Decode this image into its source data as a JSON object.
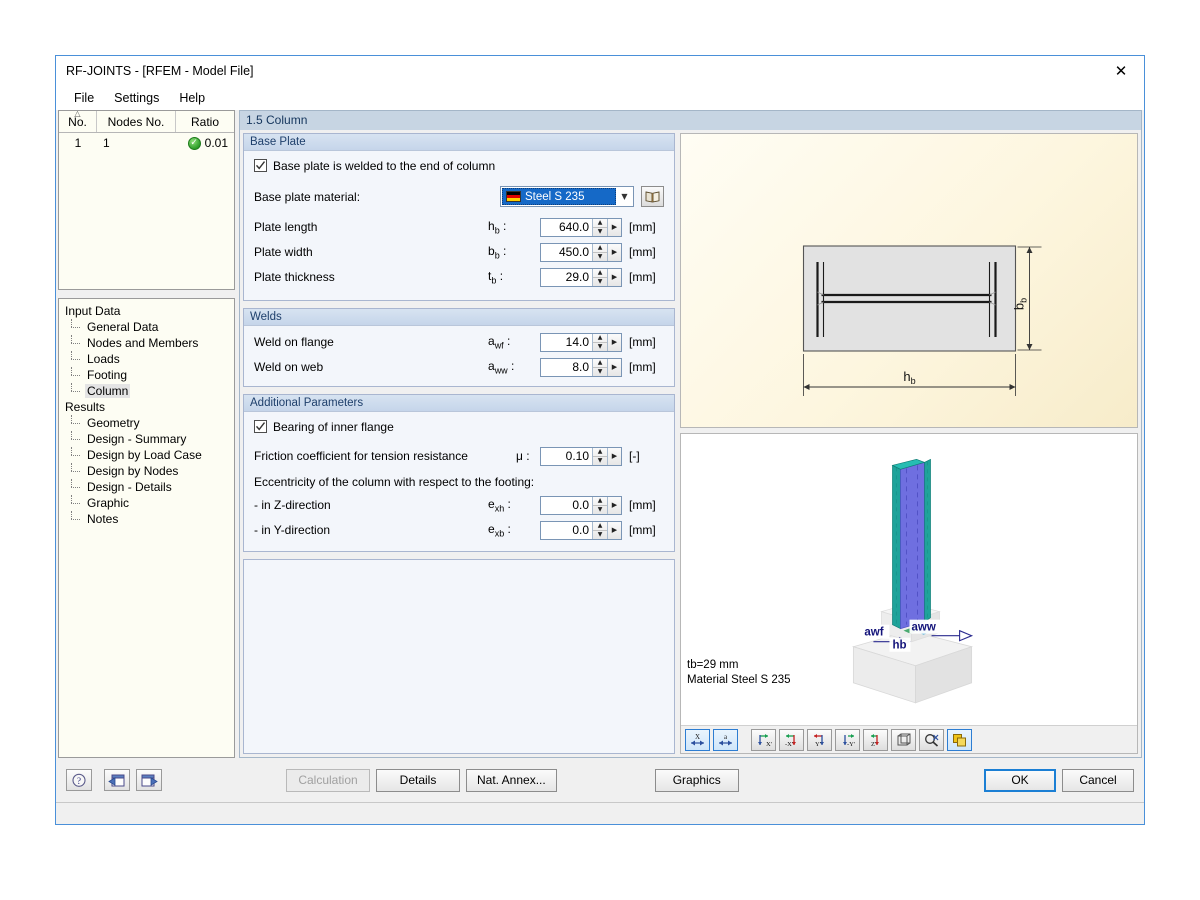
{
  "window": {
    "title": "RF-JOINTS - [RFEM - Model File]",
    "close_label": "✕"
  },
  "menu": {
    "items": [
      "File",
      "Settings",
      "Help"
    ]
  },
  "nodes_table": {
    "columns": [
      "No.",
      "Nodes No.",
      "Ratio"
    ],
    "rows": [
      {
        "no": "1",
        "nodes_no": "1",
        "ratio": "0.01",
        "status": "ok"
      }
    ]
  },
  "tree": {
    "groups": [
      {
        "label": "Input Data",
        "items": [
          "General Data",
          "Nodes and Members",
          "Loads",
          "Footing",
          "Column"
        ],
        "selected": "Column"
      },
      {
        "label": "Results",
        "items": [
          "Geometry",
          "Design - Summary",
          "Design by Load Case",
          "Design by Nodes",
          "Design - Details",
          "Graphic",
          "Notes"
        ],
        "selected": ""
      }
    ]
  },
  "tab": {
    "title": "1.5 Column"
  },
  "base_plate": {
    "title": "Base Plate",
    "welded_checkbox": {
      "label": "Base plate is welded to the end of column",
      "checked": true
    },
    "material_label": "Base plate material:",
    "material_value": "Steel S 235",
    "material_flag": "german-flag",
    "library_icon": "book-icon",
    "fields": [
      {
        "label": "Plate length",
        "symbol": "h",
        "sub": "b",
        "value": "640.0",
        "unit": "[mm]"
      },
      {
        "label": "Plate width",
        "symbol": "b",
        "sub": "b",
        "value": "450.0",
        "unit": "[mm]"
      },
      {
        "label": "Plate thickness",
        "symbol": "t",
        "sub": "b",
        "value": "29.0",
        "unit": "[mm]"
      }
    ]
  },
  "welds": {
    "title": "Welds",
    "fields": [
      {
        "label": "Weld on flange",
        "symbol": "a",
        "sub": "wf",
        "value": "14.0",
        "unit": "[mm]"
      },
      {
        "label": "Weld on web",
        "symbol": "a",
        "sub": "ww",
        "value": "8.0",
        "unit": "[mm]"
      }
    ]
  },
  "additional": {
    "title": "Additional Parameters",
    "bearing_checkbox": {
      "label": "Bearing of inner flange",
      "checked": true
    },
    "friction": {
      "label": "Friction coefficient for tension resistance",
      "symbol": "μ",
      "sub": "",
      "value": "0.10",
      "unit": "[-]"
    },
    "eccentricity_note": "Eccentricity of the column with respect to the footing:",
    "fields": [
      {
        "label": "- in Z-direction",
        "symbol": "e",
        "sub": "xh",
        "value": "0.0",
        "unit": "[mm]"
      },
      {
        "label": "- in Y-direction",
        "symbol": "e",
        "sub": "xb",
        "value": "0.0",
        "unit": "[mm]"
      }
    ]
  },
  "graphic_top": {
    "dim_horizontal": "h",
    "dim_horizontal_sub": "b",
    "dim_vertical": "b",
    "dim_vertical_sub": "b"
  },
  "graphic_bottom": {
    "labels": {
      "weld_flange": "awf",
      "weld_web": "aww",
      "plate_height": "hb"
    },
    "annotation_line1": "tb=29 mm",
    "annotation_line2": "Material Steel S 235",
    "toolbar": [
      {
        "name": "dimension-x-button",
        "glyph": "X",
        "active": true
      },
      {
        "name": "dimension-a-button",
        "glyph": "a",
        "active": true
      },
      {
        "name": "view-x-button",
        "glyph": "X'",
        "active": false
      },
      {
        "name": "view-negx-button",
        "glyph": "-X'",
        "active": false
      },
      {
        "name": "view-y-button",
        "glyph": "Y'",
        "active": false
      },
      {
        "name": "view-negy-button",
        "glyph": "-Y'",
        "active": false
      },
      {
        "name": "view-z-button",
        "glyph": "Z'",
        "active": false
      },
      {
        "name": "isometric-view-button",
        "glyph": "cube",
        "active": false
      },
      {
        "name": "zoom-reset-button",
        "glyph": "zoom",
        "active": false
      },
      {
        "name": "render-mode-button",
        "glyph": "layers",
        "active": true
      }
    ]
  },
  "footer": {
    "help_icon": "help-icon",
    "prev_icon": "previous-dialog-icon",
    "next_icon": "next-dialog-icon",
    "calculation_label": "Calculation",
    "calculation_disabled": true,
    "details_label": "Details",
    "nat_annex_label": "Nat. Annex...",
    "graphics_label": "Graphics",
    "ok_label": "OK",
    "cancel_label": "Cancel"
  },
  "colors": {
    "accent": "#1b7fd4",
    "group_header": "#1e3f6b",
    "tab_header_bg": "#c7d5e3",
    "selection_blue": "#1569c7",
    "status_green": "#2e9e29"
  }
}
